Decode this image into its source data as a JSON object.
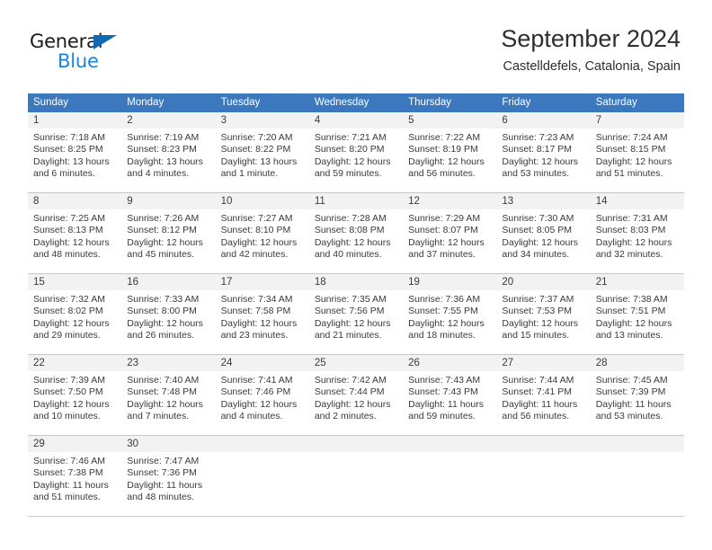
{
  "brand": {
    "name_part1": "General",
    "name_part2": "Blue",
    "triangle_icon": "triangle-icon",
    "colors": {
      "dark": "#1a1a1a",
      "blue": "#1e84d5",
      "triangle": "#1268b3"
    }
  },
  "header": {
    "title": "September 2024",
    "subtitle": "Castelldefels, Catalonia, Spain"
  },
  "calendar": {
    "accent_color": "#3c78bd",
    "day_number_bg": "#f2f2f2",
    "weekdays": [
      "Sunday",
      "Monday",
      "Tuesday",
      "Wednesday",
      "Thursday",
      "Friday",
      "Saturday"
    ],
    "weeks": [
      {
        "days": [
          {
            "num": "1",
            "sunrise": "Sunrise: 7:18 AM",
            "sunset": "Sunset: 8:25 PM",
            "daylight1": "Daylight: 13 hours",
            "daylight2": "and 6 minutes."
          },
          {
            "num": "2",
            "sunrise": "Sunrise: 7:19 AM",
            "sunset": "Sunset: 8:23 PM",
            "daylight1": "Daylight: 13 hours",
            "daylight2": "and 4 minutes."
          },
          {
            "num": "3",
            "sunrise": "Sunrise: 7:20 AM",
            "sunset": "Sunset: 8:22 PM",
            "daylight1": "Daylight: 13 hours",
            "daylight2": "and 1 minute."
          },
          {
            "num": "4",
            "sunrise": "Sunrise: 7:21 AM",
            "sunset": "Sunset: 8:20 PM",
            "daylight1": "Daylight: 12 hours",
            "daylight2": "and 59 minutes."
          },
          {
            "num": "5",
            "sunrise": "Sunrise: 7:22 AM",
            "sunset": "Sunset: 8:19 PM",
            "daylight1": "Daylight: 12 hours",
            "daylight2": "and 56 minutes."
          },
          {
            "num": "6",
            "sunrise": "Sunrise: 7:23 AM",
            "sunset": "Sunset: 8:17 PM",
            "daylight1": "Daylight: 12 hours",
            "daylight2": "and 53 minutes."
          },
          {
            "num": "7",
            "sunrise": "Sunrise: 7:24 AM",
            "sunset": "Sunset: 8:15 PM",
            "daylight1": "Daylight: 12 hours",
            "daylight2": "and 51 minutes."
          }
        ]
      },
      {
        "days": [
          {
            "num": "8",
            "sunrise": "Sunrise: 7:25 AM",
            "sunset": "Sunset: 8:13 PM",
            "daylight1": "Daylight: 12 hours",
            "daylight2": "and 48 minutes."
          },
          {
            "num": "9",
            "sunrise": "Sunrise: 7:26 AM",
            "sunset": "Sunset: 8:12 PM",
            "daylight1": "Daylight: 12 hours",
            "daylight2": "and 45 minutes."
          },
          {
            "num": "10",
            "sunrise": "Sunrise: 7:27 AM",
            "sunset": "Sunset: 8:10 PM",
            "daylight1": "Daylight: 12 hours",
            "daylight2": "and 42 minutes."
          },
          {
            "num": "11",
            "sunrise": "Sunrise: 7:28 AM",
            "sunset": "Sunset: 8:08 PM",
            "daylight1": "Daylight: 12 hours",
            "daylight2": "and 40 minutes."
          },
          {
            "num": "12",
            "sunrise": "Sunrise: 7:29 AM",
            "sunset": "Sunset: 8:07 PM",
            "daylight1": "Daylight: 12 hours",
            "daylight2": "and 37 minutes."
          },
          {
            "num": "13",
            "sunrise": "Sunrise: 7:30 AM",
            "sunset": "Sunset: 8:05 PM",
            "daylight1": "Daylight: 12 hours",
            "daylight2": "and 34 minutes."
          },
          {
            "num": "14",
            "sunrise": "Sunrise: 7:31 AM",
            "sunset": "Sunset: 8:03 PM",
            "daylight1": "Daylight: 12 hours",
            "daylight2": "and 32 minutes."
          }
        ]
      },
      {
        "days": [
          {
            "num": "15",
            "sunrise": "Sunrise: 7:32 AM",
            "sunset": "Sunset: 8:02 PM",
            "daylight1": "Daylight: 12 hours",
            "daylight2": "and 29 minutes."
          },
          {
            "num": "16",
            "sunrise": "Sunrise: 7:33 AM",
            "sunset": "Sunset: 8:00 PM",
            "daylight1": "Daylight: 12 hours",
            "daylight2": "and 26 minutes."
          },
          {
            "num": "17",
            "sunrise": "Sunrise: 7:34 AM",
            "sunset": "Sunset: 7:58 PM",
            "daylight1": "Daylight: 12 hours",
            "daylight2": "and 23 minutes."
          },
          {
            "num": "18",
            "sunrise": "Sunrise: 7:35 AM",
            "sunset": "Sunset: 7:56 PM",
            "daylight1": "Daylight: 12 hours",
            "daylight2": "and 21 minutes."
          },
          {
            "num": "19",
            "sunrise": "Sunrise: 7:36 AM",
            "sunset": "Sunset: 7:55 PM",
            "daylight1": "Daylight: 12 hours",
            "daylight2": "and 18 minutes."
          },
          {
            "num": "20",
            "sunrise": "Sunrise: 7:37 AM",
            "sunset": "Sunset: 7:53 PM",
            "daylight1": "Daylight: 12 hours",
            "daylight2": "and 15 minutes."
          },
          {
            "num": "21",
            "sunrise": "Sunrise: 7:38 AM",
            "sunset": "Sunset: 7:51 PM",
            "daylight1": "Daylight: 12 hours",
            "daylight2": "and 13 minutes."
          }
        ]
      },
      {
        "days": [
          {
            "num": "22",
            "sunrise": "Sunrise: 7:39 AM",
            "sunset": "Sunset: 7:50 PM",
            "daylight1": "Daylight: 12 hours",
            "daylight2": "and 10 minutes."
          },
          {
            "num": "23",
            "sunrise": "Sunrise: 7:40 AM",
            "sunset": "Sunset: 7:48 PM",
            "daylight1": "Daylight: 12 hours",
            "daylight2": "and 7 minutes."
          },
          {
            "num": "24",
            "sunrise": "Sunrise: 7:41 AM",
            "sunset": "Sunset: 7:46 PM",
            "daylight1": "Daylight: 12 hours",
            "daylight2": "and 4 minutes."
          },
          {
            "num": "25",
            "sunrise": "Sunrise: 7:42 AM",
            "sunset": "Sunset: 7:44 PM",
            "daylight1": "Daylight: 12 hours",
            "daylight2": "and 2 minutes."
          },
          {
            "num": "26",
            "sunrise": "Sunrise: 7:43 AM",
            "sunset": "Sunset: 7:43 PM",
            "daylight1": "Daylight: 11 hours",
            "daylight2": "and 59 minutes."
          },
          {
            "num": "27",
            "sunrise": "Sunrise: 7:44 AM",
            "sunset": "Sunset: 7:41 PM",
            "daylight1": "Daylight: 11 hours",
            "daylight2": "and 56 minutes."
          },
          {
            "num": "28",
            "sunrise": "Sunrise: 7:45 AM",
            "sunset": "Sunset: 7:39 PM",
            "daylight1": "Daylight: 11 hours",
            "daylight2": "and 53 minutes."
          }
        ]
      },
      {
        "days": [
          {
            "num": "29",
            "sunrise": "Sunrise: 7:46 AM",
            "sunset": "Sunset: 7:38 PM",
            "daylight1": "Daylight: 11 hours",
            "daylight2": "and 51 minutes."
          },
          {
            "num": "30",
            "sunrise": "Sunrise: 7:47 AM",
            "sunset": "Sunset: 7:36 PM",
            "daylight1": "Daylight: 11 hours",
            "daylight2": "and 48 minutes."
          },
          {
            "num": "",
            "sunrise": "",
            "sunset": "",
            "daylight1": "",
            "daylight2": ""
          },
          {
            "num": "",
            "sunrise": "",
            "sunset": "",
            "daylight1": "",
            "daylight2": ""
          },
          {
            "num": "",
            "sunrise": "",
            "sunset": "",
            "daylight1": "",
            "daylight2": ""
          },
          {
            "num": "",
            "sunrise": "",
            "sunset": "",
            "daylight1": "",
            "daylight2": ""
          },
          {
            "num": "",
            "sunrise": "",
            "sunset": "",
            "daylight1": "",
            "daylight2": ""
          }
        ]
      }
    ]
  }
}
